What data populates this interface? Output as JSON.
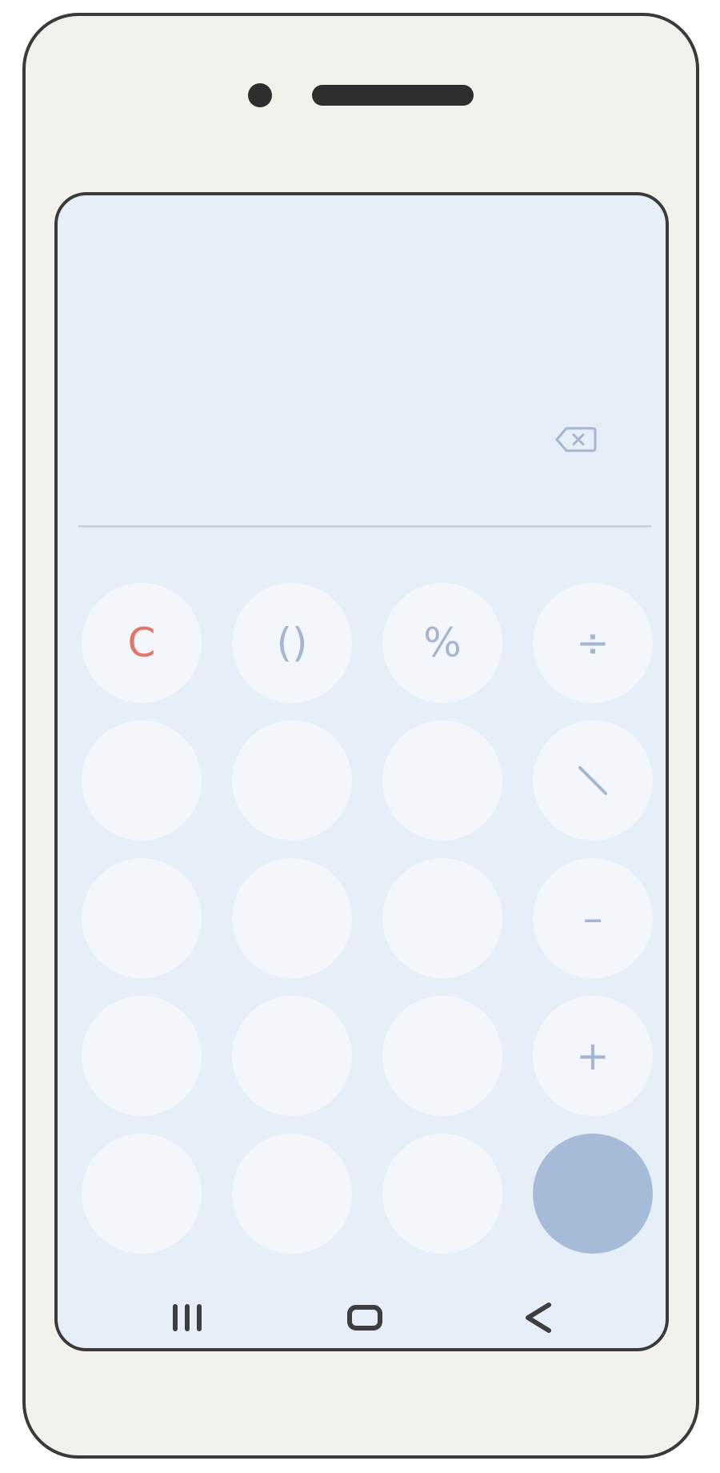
{
  "keypad": {
    "clear": "C",
    "parentheses": "()",
    "percent": "%",
    "divide": "÷",
    "multiply": "",
    "minus": "–",
    "plus": "+",
    "equals": ""
  },
  "display": {
    "backspace_icon": "backspace-icon"
  },
  "navbar": {
    "recents_icon": "recents-icon",
    "home_icon": "home-icon",
    "back_icon": "back-icon"
  },
  "colors": {
    "screen_bg": "#e6eef8",
    "key_bg": "#f3f7fc",
    "operator_text": "#a6b6d1",
    "clear_text": "#e1776a",
    "equals_bg": "#a6bbd8",
    "phone_body": "#f3f1ec"
  }
}
